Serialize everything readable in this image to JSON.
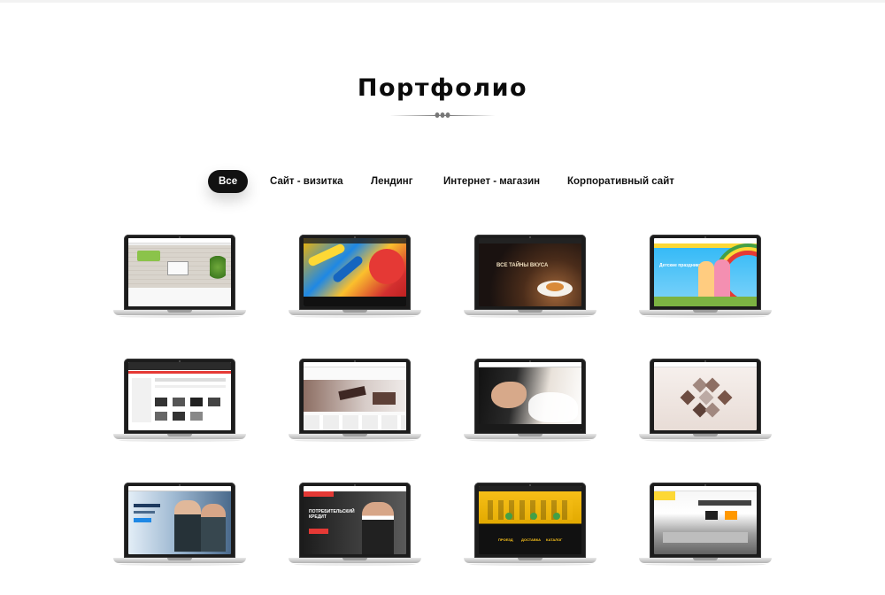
{
  "page": {
    "title": "Портфолио"
  },
  "filters": [
    {
      "label": "Все",
      "active": true
    },
    {
      "label": "Сайт - визитка",
      "active": false
    },
    {
      "label": "Лендинг",
      "active": false
    },
    {
      "label": "Интернет - магазин",
      "active": false
    },
    {
      "label": "Корпоративный сайт",
      "active": false
    }
  ],
  "portfolio": {
    "items": [
      {
        "screen": "interior-design-site"
      },
      {
        "screen": "waterpark-slides-site"
      },
      {
        "screen": "restaurant-dark-site",
        "heading": "ВСЕ ТАЙНЫ ВКУСА"
      },
      {
        "screen": "kids-rainbow-site",
        "heading": "Детские праздники"
      },
      {
        "screen": "online-store-catalog"
      },
      {
        "screen": "furniture-store-site"
      },
      {
        "screen": "spa-salon-site"
      },
      {
        "screen": "portfolio-gallery-site"
      },
      {
        "screen": "business-consulting-site"
      },
      {
        "screen": "bank-credit-site",
        "heading": "ПОТРЕБИТЕЛЬСКИЙ КРЕДИТ"
      },
      {
        "screen": "taxi-service-site",
        "buttons": [
          "ПРОЕЗД",
          "ДОСТАВКА",
          "КАТАЛОГ"
        ]
      },
      {
        "screen": "kitchen-interior-site"
      }
    ]
  }
}
